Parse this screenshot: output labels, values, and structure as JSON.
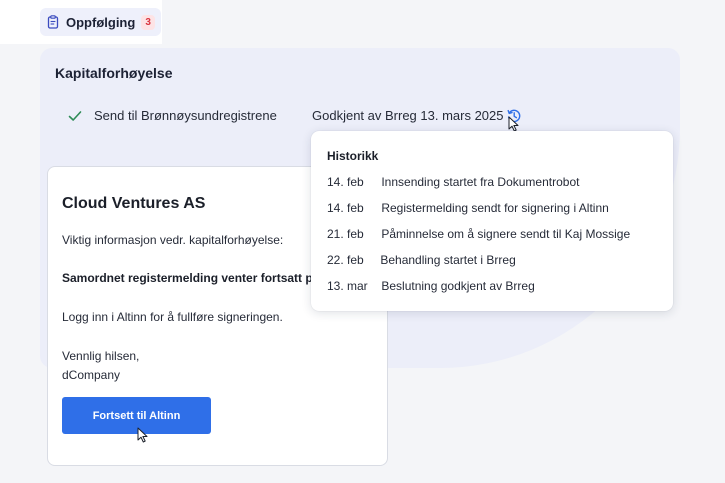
{
  "tab": {
    "label": "Oppfølging",
    "badge": "3",
    "icon": "clipboard-icon"
  },
  "section": {
    "title": "Kapitalforhøyelse"
  },
  "step": {
    "label": "Send til Brønnøysundregistrene",
    "status": "Godkjent av Brreg 13. mars 2025",
    "status_icon": "check-icon",
    "history_icon": "history-icon"
  },
  "email": {
    "company": "Cloud Ventures AS",
    "intro": "Viktig informasjon vedr. kapitalforhøyelse:",
    "headline": "Samordnet registermelding venter fortsatt på signering",
    "instruction": "Logg inn i Altinn for å fullføre signeringen.",
    "greeting": "Vennlig hilsen,",
    "sender": "dCompany",
    "button_label": "Fortsett til Altinn"
  },
  "history": {
    "heading": "Historikk",
    "items": [
      {
        "date": "14. feb",
        "text": "Innsending startet fra Dokumentrobot"
      },
      {
        "date": "14. feb",
        "text": "Registermelding sendt for signering i Altinn"
      },
      {
        "date": "21. feb",
        "text": "Påminnelse om å signere sendt til Kaj Mossige"
      },
      {
        "date": "22. feb",
        "text": "Behandling startet i Brreg"
      },
      {
        "date": "13. mar",
        "text": "Beslutning godkjent av Brreg"
      }
    ]
  },
  "colors": {
    "accent": "#2f6fe8",
    "success": "#2e8b57",
    "badge_text": "#d8343f",
    "badge_bg": "#fde3e5"
  }
}
